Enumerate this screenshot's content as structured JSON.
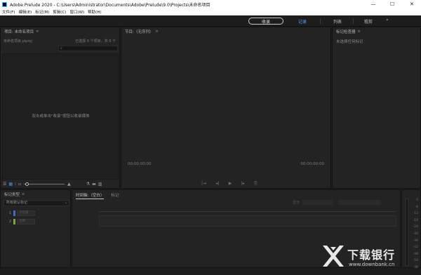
{
  "window": {
    "title": "Adobe Prelude 2020 - C:\\Users\\Administrator\\Documents\\Adobe\\Prelude\\9.0\\Projects\\未命名项目",
    "controls": [
      "—",
      "☐",
      "✕"
    ]
  },
  "menu": [
    "文件(F)",
    "编辑(E)",
    "标记(M)",
    "剪辑(C)",
    "窗口(W)",
    "帮助(H)"
  ],
  "workspaces": {
    "capture": "收录",
    "log": "记录",
    "list": "列表",
    "rough_cut": "粗剪",
    "more": "»",
    "active_color": "#4da6ff"
  },
  "project_panel": {
    "title": "项目: 未命名项目",
    "file_name": "未命名项目.plproj",
    "selection_count": "已选择 0 个项目，共 0 个",
    "empty_hint": "双击或单击\"收录\"按钮以收录媒体"
  },
  "monitor_panel": {
    "title": "节目:（无序列）",
    "timecode_left": "00;00;00;00",
    "timecode_right": "00;00;00;00"
  },
  "inspector_panel": {
    "title": "标记检查器",
    "empty_text": "未选择任何标记"
  },
  "marker_type_panel": {
    "title": "标记类型",
    "selected": "所有默认标记",
    "rows": [
      {
        "num": "1",
        "label": "子剪辑",
        "color": "#3a6fc4"
      },
      {
        "num": "2",
        "label": "注释",
        "color": "#7aa83c"
      }
    ]
  },
  "timeline_panel": {
    "tab_active": "时间轴:（空白）",
    "tab_other": "标记",
    "zoom_label": "显示"
  },
  "meter": {
    "scale": [
      "0",
      "-6",
      "-12",
      "-18",
      "-24",
      "-30",
      "-36",
      "-42",
      "-48",
      "-54",
      "dB"
    ]
  },
  "watermark": {
    "text": "下载银行",
    "url": "www.downbank.cn"
  }
}
